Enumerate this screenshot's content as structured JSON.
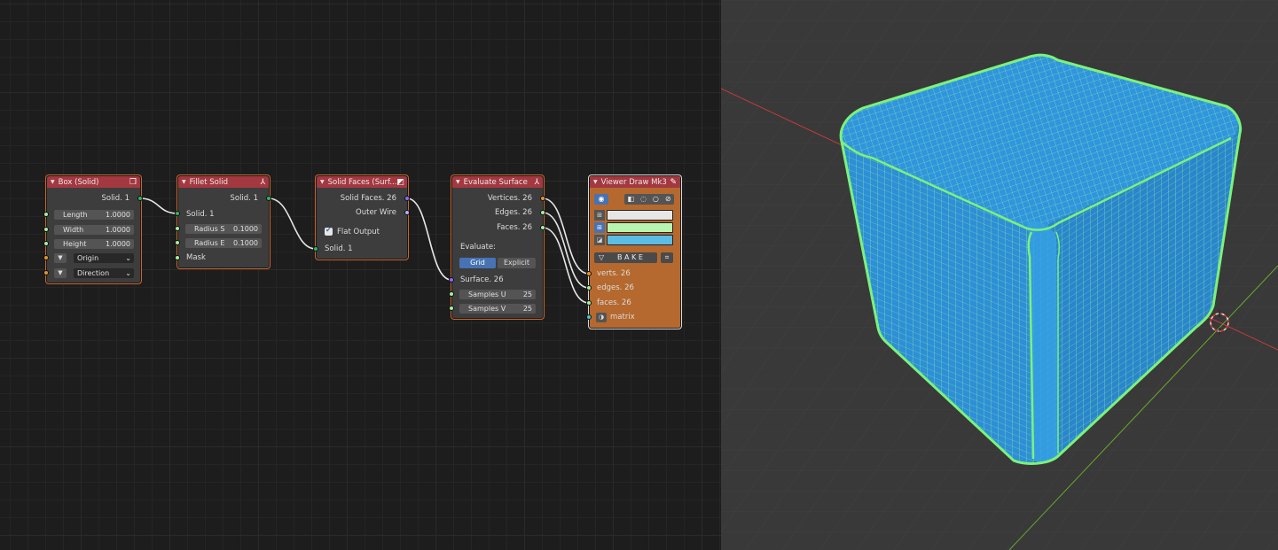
{
  "colors": {
    "node_header": "#a33841",
    "node_body": "#3d3d3d",
    "node_frame": "#c7652e",
    "viewer_body": "#b5692e",
    "wire": "#e6e6e6",
    "mesh_blue": "#2d8fd6",
    "edge_green": "#7cf27a",
    "axis_red": "#c33b3b",
    "axis_green": "#6aa82a",
    "swatch_white": "#e6e6e6",
    "swatch_green": "#b8f5b0",
    "swatch_blue": "#5bbce6"
  },
  "nodes": {
    "box": {
      "title": "Box (Solid)",
      "icon": "cube-icon",
      "output": "Solid. 1",
      "fields": [
        {
          "label": "Length",
          "value": "1.0000"
        },
        {
          "label": "Width",
          "value": "1.0000"
        },
        {
          "label": "Height",
          "value": "1.0000"
        }
      ],
      "dropdowns": [
        "Origin",
        "Direction"
      ]
    },
    "fillet": {
      "title": "Fillet Solid",
      "icon": "fillet-icon",
      "output": "Solid. 1",
      "input": "Solid. 1",
      "fields": [
        {
          "label": "Radius S",
          "value": "0.1000"
        },
        {
          "label": "Radius E",
          "value": "0.1000"
        }
      ],
      "mask": "Mask"
    },
    "solid_faces": {
      "title": "Solid Faces (Surf...",
      "icon": "surface-icon",
      "outputs": [
        "Solid Faces. 26",
        "Outer Wire"
      ],
      "checkbox_label": "Flat Output",
      "checkbox_checked": true,
      "input": "Solid. 1"
    },
    "evaluate": {
      "title": "Evaluate Surface",
      "icon": "evaluate-icon",
      "outputs": [
        "Vertices. 26",
        "Edges. 26",
        "Faces. 26"
      ],
      "evaluate_label": "Evaluate:",
      "modes": [
        "Grid",
        "Explicit"
      ],
      "active_mode": "Grid",
      "input": "Surface. 26",
      "samples": [
        {
          "label": "Samples U",
          "value": "25"
        },
        {
          "label": "Samples V",
          "value": "25"
        }
      ]
    },
    "viewer": {
      "title": "Viewer Draw Mk3",
      "icon": "pencil-icon",
      "bake_label": "B A K E",
      "inputs": [
        "verts. 26",
        "edges. 26",
        "faces. 26",
        "matrix"
      ]
    }
  }
}
